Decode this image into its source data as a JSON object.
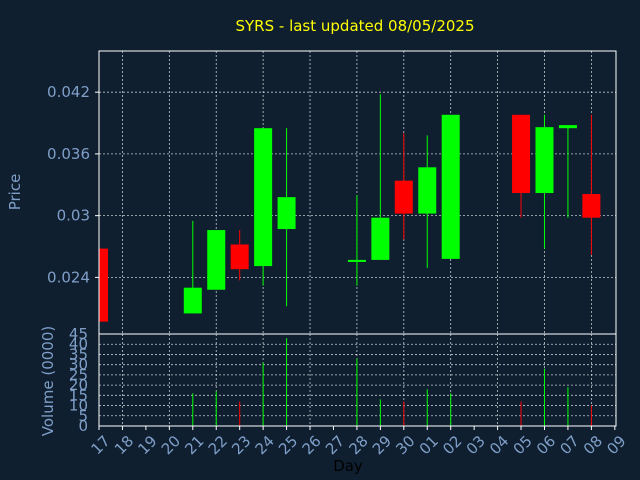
{
  "chart_data": {
    "type": "candlestick",
    "title": "SYRS - last updated 08/05/2025",
    "xlabel": "Day",
    "price_panel": {
      "ylabel": "Price",
      "ylim": [
        0.0185,
        0.046
      ],
      "yticks": [
        0.024,
        0.03,
        0.036,
        0.042
      ],
      "ytick_labels": [
        "0.024",
        "0.03",
        "0.036",
        "0.042"
      ]
    },
    "volume_panel": {
      "ylabel": "Volume (0000)",
      "ylim": [
        0,
        45
      ],
      "yticks": [
        0,
        5,
        10,
        15,
        20,
        25,
        30,
        35,
        40,
        45
      ],
      "ytick_labels": [
        "0",
        "5",
        "10",
        "15",
        "20",
        "25",
        "30",
        "35",
        "40",
        "45"
      ]
    },
    "x_tick_labels": [
      "17",
      "18",
      "19",
      "20",
      "21",
      "22",
      "23",
      "24",
      "25",
      "26",
      "27",
      "28",
      "29",
      "30",
      "01",
      "02",
      "03",
      "04",
      "05",
      "06",
      "07",
      "08",
      "09"
    ],
    "candles": [
      {
        "x": "17",
        "open": 0.0268,
        "close": 0.0197,
        "high": 0.0268,
        "low": 0.0197,
        "volume": 0
      },
      {
        "x": "21",
        "open": 0.0205,
        "close": 0.023,
        "high": 0.0295,
        "low": 0.0205,
        "volume": 16
      },
      {
        "x": "22",
        "open": 0.0228,
        "close": 0.0286,
        "high": 0.0286,
        "low": 0.0228,
        "volume": 17
      },
      {
        "x": "23",
        "open": 0.0272,
        "close": 0.0248,
        "high": 0.0286,
        "low": 0.0237,
        "volume": 12
      },
      {
        "x": "24",
        "open": 0.0251,
        "close": 0.0385,
        "high": 0.0385,
        "low": 0.0232,
        "volume": 31
      },
      {
        "x": "25",
        "open": 0.0287,
        "close": 0.0318,
        "high": 0.0385,
        "low": 0.0212,
        "volume": 43
      },
      {
        "x": "28",
        "open": 0.0255,
        "close": 0.0257,
        "high": 0.032,
        "low": 0.0232,
        "volume": 33
      },
      {
        "x": "29",
        "open": 0.0257,
        "close": 0.0298,
        "high": 0.0418,
        "low": 0.0257,
        "volume": 13
      },
      {
        "x": "30",
        "open": 0.0334,
        "close": 0.0302,
        "high": 0.038,
        "low": 0.0277,
        "volume": 12
      },
      {
        "x": "01",
        "open": 0.0302,
        "close": 0.0347,
        "high": 0.0378,
        "low": 0.0249,
        "volume": 18
      },
      {
        "x": "02",
        "open": 0.0258,
        "close": 0.0398,
        "high": 0.0398,
        "low": 0.0258,
        "volume": 16
      },
      {
        "x": "05",
        "open": 0.0398,
        "close": 0.0322,
        "high": 0.0398,
        "low": 0.0298,
        "volume": 12
      },
      {
        "x": "06",
        "open": 0.0322,
        "close": 0.0386,
        "high": 0.0398,
        "low": 0.0268,
        "volume": 28
      },
      {
        "x": "07",
        "open": 0.0385,
        "close": 0.0388,
        "high": 0.0388,
        "low": 0.0298,
        "volume": 19
      },
      {
        "x": "08",
        "open": 0.0321,
        "close": 0.0298,
        "high": 0.0398,
        "low": 0.0262,
        "volume": 10
      }
    ],
    "up_color": "#00ff00",
    "down_color": "#ff0000",
    "grid": true
  }
}
